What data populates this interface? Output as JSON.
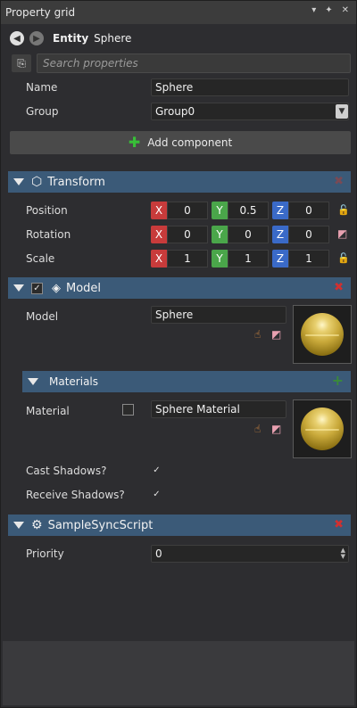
{
  "window": {
    "title": "Property grid",
    "controls": [
      "▾",
      "✦",
      "✕"
    ]
  },
  "nav": {
    "entity_keyword": "Entity",
    "entity_name": "Sphere"
  },
  "search": {
    "placeholder": "Search properties"
  },
  "props": {
    "name_label": "Name",
    "name_value": "Sphere",
    "group_label": "Group",
    "group_value": "Group0"
  },
  "add_component": {
    "label": "Add component"
  },
  "transform": {
    "title": "Transform",
    "position_label": "Position",
    "position": {
      "x": "0",
      "y": "0.5",
      "z": "0"
    },
    "rotation_label": "Rotation",
    "rotation": {
      "x": "0",
      "y": "0",
      "z": "0"
    },
    "scale_label": "Scale",
    "scale": {
      "x": "1",
      "y": "1",
      "z": "1"
    },
    "axis_labels": {
      "x": "X",
      "y": "Y",
      "z": "Z"
    }
  },
  "model": {
    "title": "Model",
    "model_label": "Model",
    "model_value": "Sphere",
    "materials_title": "Materials",
    "material_label": "Material",
    "material_value": "Sphere Material",
    "cast_shadows_label": "Cast Shadows?",
    "receive_shadows_label": "Receive Shadows?"
  },
  "script": {
    "title": "SampleSyncScript",
    "priority_label": "Priority",
    "priority_value": "0"
  },
  "colors": {
    "section_header": "#3b5a78",
    "axis_x": "#c83b3b",
    "axis_y": "#4aa64a",
    "axis_z": "#3a6ac8",
    "delete": "#d03030",
    "add": "#38c038"
  }
}
